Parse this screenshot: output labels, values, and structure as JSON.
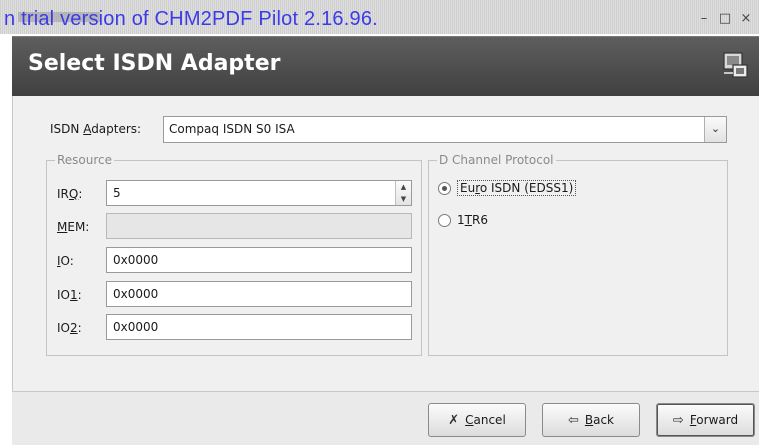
{
  "titlebar": {
    "watermark": "n trial version of CHM2PDF Pilot 2.16.96.",
    "minimize": "–",
    "maximize": "□",
    "close": "×"
  },
  "header": {
    "title": "Select ISDN Adapter",
    "icon": "network-card-icon"
  },
  "adapter": {
    "label_pre": "ISDN ",
    "label_mn": "A",
    "label_post": "dapters:",
    "value": "Compaq ISDN S0 ISA",
    "dropdown_icon": "chevron-down-icon"
  },
  "resource": {
    "legend": "Resource",
    "irq": {
      "label_pre": "IR",
      "label_mn": "Q",
      "label_post": ":",
      "value": "5"
    },
    "mem": {
      "label_pre": "",
      "label_mn": "M",
      "label_post": "EM:",
      "value": ""
    },
    "io": {
      "label_pre": "",
      "label_mn": "I",
      "label_post": "O:",
      "value": "0x0000"
    },
    "io1": {
      "label_pre": "IO",
      "label_mn": "1",
      "label_post": ":",
      "value": "0x0000"
    },
    "io2": {
      "label_pre": "IO",
      "label_mn": "2",
      "label_post": ":",
      "value": "0x0000"
    }
  },
  "protocol": {
    "legend": "D Channel Protocol",
    "options": [
      {
        "pre": "Eu",
        "mn": "r",
        "post": "o ISDN (EDSS1)",
        "selected": true
      },
      {
        "pre": "1",
        "mn": "T",
        "post": "R6",
        "selected": false
      }
    ]
  },
  "buttons": {
    "cancel": {
      "mn": "C",
      "rest": "ancel",
      "icon": "cancel-icon"
    },
    "back": {
      "mn": "B",
      "rest": "ack",
      "icon": "back-arrow-icon"
    },
    "forward": {
      "mn": "F",
      "rest": "orward",
      "icon": "forward-arrow-icon"
    }
  }
}
